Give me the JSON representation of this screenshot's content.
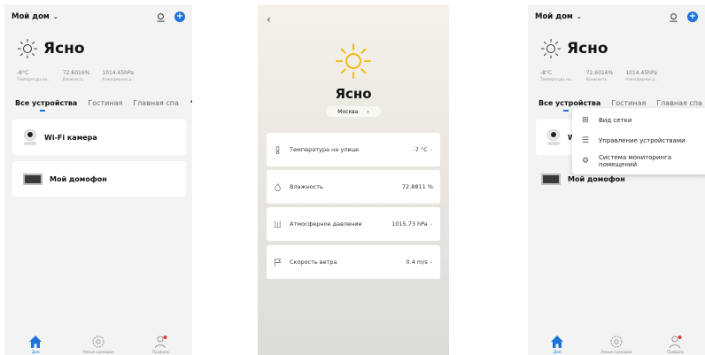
{
  "screen_home": {
    "home_name": "Мой дом",
    "weather": "Ясно",
    "temperature": "-8°C",
    "temperature_label": "Температура на...",
    "humidity": "72.6016%",
    "humidity_label": "Влажность",
    "pressure": "1014.45hPa",
    "pressure_label": "Атмосферное д...",
    "tabs": [
      "Все устройства",
      "Гостиная",
      "Главная спа"
    ],
    "devices": [
      "Wi-Fi камера",
      "Мой домофон"
    ],
    "nav": [
      "Дом",
      "Умные сценарии",
      "Профиль"
    ]
  },
  "screen_weather": {
    "weather": "Ясно",
    "city": "Москва",
    "items": [
      {
        "label": "Температура на улице",
        "value": "-7 °C"
      },
      {
        "label": "Влажность",
        "value": "72.8811 %"
      },
      {
        "label": "Атмосферное давление",
        "value": "1015.73 hPa"
      },
      {
        "label": "Скорость ветра",
        "value": "0.4 m/s"
      }
    ]
  },
  "screen_menu": {
    "home_name": "Мой дом",
    "weather": "Ясно",
    "temperature": "-8°C",
    "temperature_label": "Температура на...",
    "humidity": "72.6016%",
    "humidity_label": "Влажность",
    "pressure": "1014.45hPa",
    "pressure_label": "Атмосферное д...",
    "tabs": [
      "Все устройства",
      "Гостиная",
      "Главная спа"
    ],
    "device_partial": "W",
    "device_2": "Мой домофон",
    "menu_items": [
      "Вид сетки",
      "Управление устройствами",
      "Система мониторинга помещений"
    ],
    "nav": [
      "Дом",
      "Умные сценарии",
      "Профиль"
    ]
  },
  "colors": {
    "accent": "#1e73d8",
    "notification": "#e53935"
  }
}
